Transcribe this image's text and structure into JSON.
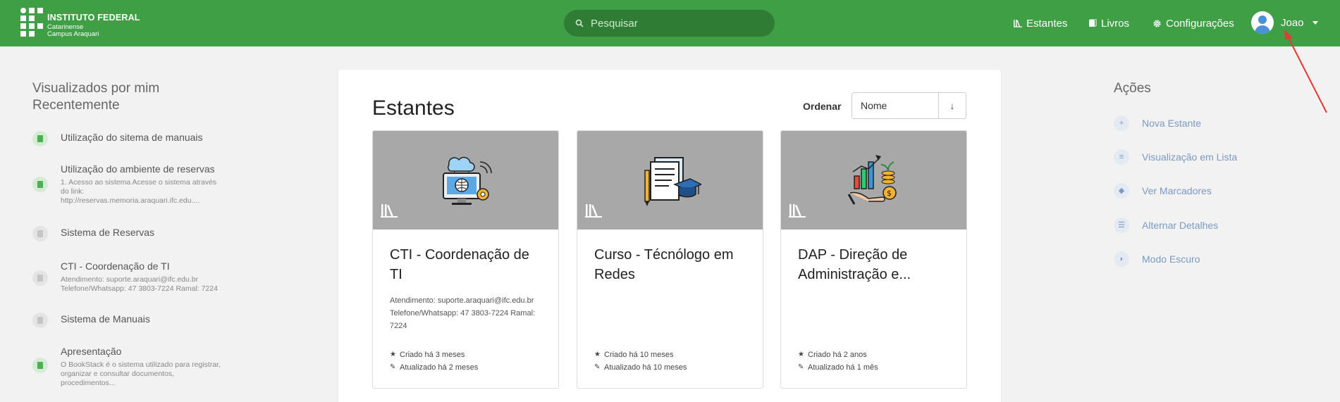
{
  "header": {
    "brand_title": "INSTITUTO FEDERAL",
    "brand_line1": "Catarinense",
    "brand_line2": "Campus Araquari",
    "search_placeholder": "Pesquisar",
    "nav": [
      {
        "label": "Estantes",
        "icon": "shelves-icon"
      },
      {
        "label": "Livros",
        "icon": "books-icon"
      },
      {
        "label": "Configurações",
        "icon": "gear-icon"
      }
    ],
    "user_name": "Joao"
  },
  "recent": {
    "title": "Visualizados por mim Recentemente",
    "items": [
      {
        "title": "Utilização do sitema de manuais",
        "desc": "",
        "icon_color": "green"
      },
      {
        "title": "Utilização do ambiente de reservas",
        "desc": "1. Acesso ao sistema Acesse o sistema através do link: http://reservas.memoria.araquari.ifc.edu....",
        "icon_color": "green"
      },
      {
        "title": "Sistema de Reservas",
        "desc": "",
        "icon_color": "gray"
      },
      {
        "title": "CTI - Coordenação de TI",
        "desc": "Atendimento: suporte.araquari@ifc.edu.br Telefone/Whatsapp: 47 3803-7224 Ramal: 7224",
        "icon_color": "gray"
      },
      {
        "title": "Sistema de Manuais",
        "desc": "",
        "icon_color": "gray"
      },
      {
        "title": "Apresentação",
        "desc": "O BookStack é o sistema utilizado para registrar, organizar e consultar documentos, procedimentos...",
        "icon_color": "green"
      }
    ]
  },
  "main": {
    "title": "Estantes",
    "order_label": "Ordenar",
    "order_value": "Nome",
    "order_direction": "↓",
    "shelves": [
      {
        "title": "CTI - Coordenação de TI",
        "desc": "Atendimento: suporte.araquari@ifc.edu.br Telefone/Whatsapp: 47 3803-7224 Ramal: 7224",
        "created": "Criado há 3 meses",
        "updated": "Atualizado há 2 meses",
        "icon": "computer-cloud-icon"
      },
      {
        "title": "Curso - Técnólogo em Redes",
        "desc": "",
        "created": "Criado há 10 meses",
        "updated": "Atualizado há 10 meses",
        "icon": "documents-graduation-icon"
      },
      {
        "title": "DAP - Direção de Administração e...",
        "desc": "",
        "created": "Criado há 2 anos",
        "updated": "Atualizado há 1 mês",
        "icon": "chart-coins-icon"
      }
    ]
  },
  "actions": {
    "title": "Ações",
    "items": [
      {
        "label": "Nova Estante",
        "icon": "plus-icon",
        "glyph": "+"
      },
      {
        "label": "Visualização em Lista",
        "icon": "list-icon",
        "glyph": "≡"
      },
      {
        "label": "Ver Marcadores",
        "icon": "tag-icon",
        "glyph": "◆"
      },
      {
        "label": "Alternar Detalhes",
        "icon": "details-icon",
        "glyph": "☰"
      },
      {
        "label": "Modo Escuro",
        "icon": "moon-icon",
        "glyph": "◗"
      }
    ]
  },
  "colors": {
    "header_green": "#3f9f45",
    "link_blue": "#7a99c4",
    "annotation_red": "#e53935"
  }
}
